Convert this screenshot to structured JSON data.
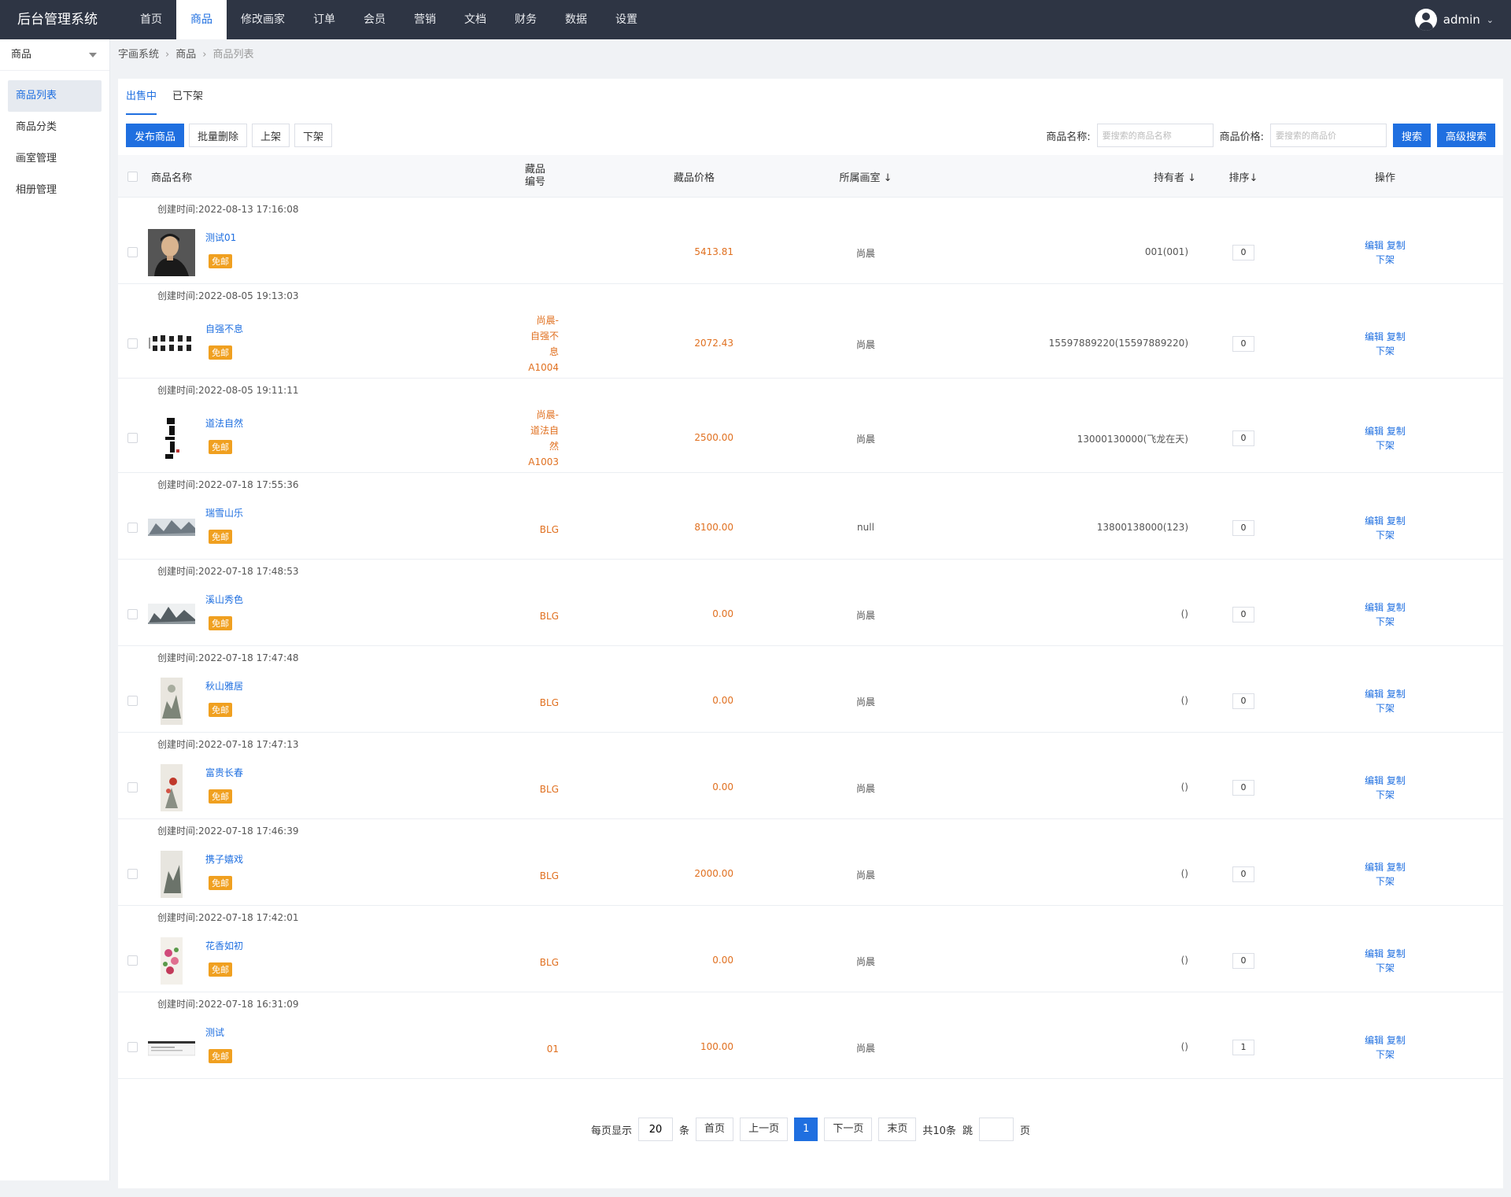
{
  "brand": "后台管理系统",
  "nav": [
    {
      "label": "首页",
      "active": false
    },
    {
      "label": "商品",
      "active": true
    },
    {
      "label": "修改画家",
      "active": false
    },
    {
      "label": "订单",
      "active": false
    },
    {
      "label": "会员",
      "active": false
    },
    {
      "label": "营销",
      "active": false
    },
    {
      "label": "文档",
      "active": false
    },
    {
      "label": "财务",
      "active": false
    },
    {
      "label": "数据",
      "active": false
    },
    {
      "label": "设置",
      "active": false
    }
  ],
  "user": {
    "name": "admin"
  },
  "sidebar": {
    "head": "商品",
    "items": [
      {
        "label": "商品列表",
        "active": true
      },
      {
        "label": "商品分类",
        "active": false
      },
      {
        "label": "画室管理",
        "active": false
      },
      {
        "label": "相册管理",
        "active": false
      }
    ]
  },
  "breadcrumb": [
    "字画系统",
    "商品",
    "商品列表"
  ],
  "tabs": [
    {
      "label": "出售中",
      "active": true
    },
    {
      "label": "已下架",
      "active": false
    }
  ],
  "toolbar": {
    "publish": "发布商品",
    "batch_delete": "批量删除",
    "on_shelf": "上架",
    "off_shelf": "下架"
  },
  "search": {
    "name_label": "商品名称:",
    "name_placeholder": "要搜索的商品名称",
    "price_label": "商品价格:",
    "price_placeholder": "要搜索的商品价",
    "search_btn": "搜索",
    "advanced_btn": "高级搜索"
  },
  "table": {
    "headers": {
      "name": "商品名称",
      "code": "藏品\n编号",
      "price": "藏品价格",
      "studio": "所属画室 ↓",
      "owner": "持有者 ↓",
      "sort": "排序↓",
      "ops": "操作"
    },
    "created_label": "创建时间:",
    "badge": "免邮",
    "ops": {
      "edit": "编辑",
      "copy": "复制",
      "off": "下架"
    },
    "rows": [
      {
        "created": "2022-08-13 17:16:08",
        "name": "测试01",
        "code": "",
        "price": "5413.81",
        "studio": "尚晨",
        "owner": "001(001)",
        "sort": "0",
        "thumb": "portrait"
      },
      {
        "created": "2022-08-05 19:13:03",
        "name": "自强不息",
        "code": "尚晨-\n自强不\n息\nA1004",
        "price": "2072.43",
        "studio": "尚晨",
        "owner": "15597889220(15597889220)",
        "sort": "0",
        "thumb": "calligraphy-h"
      },
      {
        "created": "2022-08-05 19:11:11",
        "name": "道法自然",
        "code": "尚晨-\n道法自\n然\nA1003",
        "price": "2500.00",
        "studio": "尚晨",
        "owner": "13000130000(飞龙在天)",
        "sort": "0",
        "thumb": "calligraphy-v"
      },
      {
        "created": "2022-07-18 17:55:36",
        "name": "瑞雪山乐",
        "code": "BLG",
        "price": "8100.00",
        "studio": "null",
        "owner": "13800138000(123)",
        "sort": "0",
        "thumb": "landscape-wide"
      },
      {
        "created": "2022-07-18 17:48:53",
        "name": "溪山秀色",
        "code": "BLG",
        "price": "0.00",
        "studio": "尚晨",
        "owner": "()",
        "sort": "0",
        "thumb": "landscape-wide2"
      },
      {
        "created": "2022-07-18 17:47:48",
        "name": "秋山雅居",
        "code": "BLG",
        "price": "0.00",
        "studio": "尚晨",
        "owner": "()",
        "sort": "0",
        "thumb": "scroll"
      },
      {
        "created": "2022-07-18 17:47:13",
        "name": "富贵长春",
        "code": "BLG",
        "price": "0.00",
        "studio": "尚晨",
        "owner": "()",
        "sort": "0",
        "thumb": "scroll-red"
      },
      {
        "created": "2022-07-18 17:46:39",
        "name": "携子嬉戏",
        "code": "BLG",
        "price": "2000.00",
        "studio": "尚晨",
        "owner": "()",
        "sort": "0",
        "thumb": "scroll2"
      },
      {
        "created": "2022-07-18 17:42:01",
        "name": "花香如初",
        "code": "BLG",
        "price": "0.00",
        "studio": "尚晨",
        "owner": "()",
        "sort": "0",
        "thumb": "flowers"
      },
      {
        "created": "2022-07-18 16:31:09",
        "name": "测试",
        "code": "01",
        "price": "100.00",
        "studio": "尚晨",
        "owner": "()",
        "sort": "1",
        "thumb": "screenshot"
      }
    ]
  },
  "pager": {
    "per_page_label": "每页显示",
    "per_page": "20",
    "per_page_unit": "条",
    "first": "首页",
    "prev": "上一页",
    "current": "1",
    "next": "下一页",
    "last": "末页",
    "total": "共10条",
    "jump_label": "跳",
    "jump_unit": "页"
  }
}
